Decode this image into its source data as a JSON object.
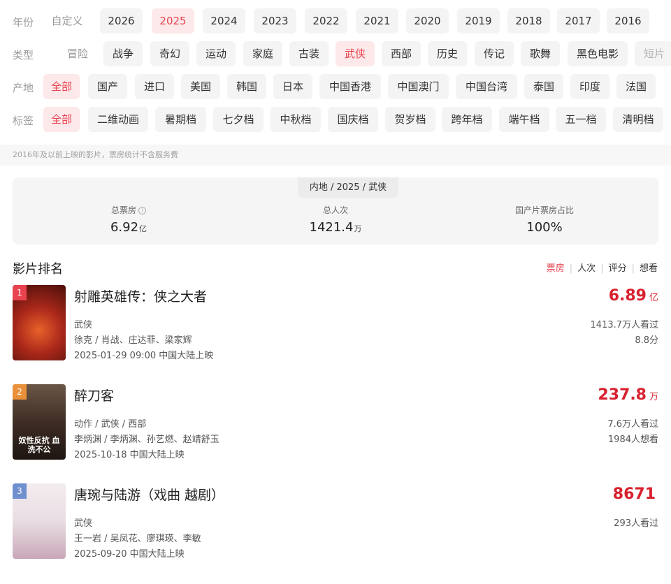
{
  "filters": {
    "year": {
      "label": "年份",
      "options": [
        "自定义",
        "2026",
        "2025",
        "2024",
        "2023",
        "2022",
        "2021",
        "2020",
        "2019",
        "2018",
        "2017",
        "2016"
      ],
      "selected": "2025"
    },
    "genre": {
      "label": "类型",
      "options": [
        "冒险",
        "战争",
        "奇幻",
        "运动",
        "家庭",
        "古装",
        "武侠",
        "西部",
        "历史",
        "传记",
        "歌舞",
        "黑色电影",
        "短片"
      ],
      "selected": "武侠"
    },
    "region": {
      "label": "产地",
      "options": [
        "全部",
        "国产",
        "进口",
        "美国",
        "韩国",
        "日本",
        "中国香港",
        "中国澳门",
        "中国台湾",
        "泰国",
        "印度",
        "法国"
      ],
      "selected": "全部"
    },
    "tag": {
      "label": "标签",
      "options": [
        "全部",
        "二维动画",
        "暑期档",
        "七夕档",
        "中秋档",
        "国庆档",
        "贺岁档",
        "跨年档",
        "端午档",
        "五一档",
        "清明档"
      ],
      "selected": "全部"
    }
  },
  "note": "2016年及以前上映的影片，票房统计不含服务费",
  "summary": {
    "crumb": "内地 / 2025 / 武侠",
    "total_box_label": "总票房",
    "total_box_value": "6.92",
    "total_box_unit": "亿",
    "total_viewers_label": "总人次",
    "total_viewers_value": "1421.4",
    "total_viewers_unit": "万",
    "domestic_share_label": "国产片票房占比",
    "domestic_share_value": "100%"
  },
  "ranking": {
    "title": "影片排名",
    "sorts": [
      "票房",
      "人次",
      "评分",
      "想看"
    ],
    "active_sort": "票房",
    "items": [
      {
        "rank": "1",
        "title": "射雕英雄传：侠之大者",
        "genre": "武侠",
        "people": "徐克 / 肖战、庄达菲、梁家辉",
        "release": "2025-01-29 09:00 中国大陆上映",
        "box": "6.89",
        "box_unit": "亿",
        "stat1": "1413.7万人看过",
        "stat2": "8.8分",
        "badge_color": "#e8434f",
        "poster_bg": "#7a1a10",
        "poster_text": ""
      },
      {
        "rank": "2",
        "title": "醉刀客",
        "genre": "动作 / 武侠 / 西部",
        "people": "李炳渊 / 李炳渊、孙艺燃、赵靖舒玉",
        "release": "2025-10-18 中国大陆上映",
        "box": "237.8",
        "box_unit": "万",
        "stat1": "7.6万人看过",
        "stat2": "1984人想看",
        "badge_color": "#e8903a",
        "poster_bg": "#3b2a22",
        "poster_text": "奴性反抗 血洗不公"
      },
      {
        "rank": "3",
        "title": "唐琬与陆游（戏曲 越剧）",
        "genre": "武侠",
        "people": "王一岩 / 吴凤花、廖琪瑛、李敏",
        "release": "2025-09-20 中国大陆上映",
        "box": "8671",
        "box_unit": "",
        "stat1": "293人看过",
        "stat2": "",
        "badge_color": "#6f8fcf",
        "poster_bg": "#efe6ea",
        "poster_text": ""
      }
    ]
  }
}
